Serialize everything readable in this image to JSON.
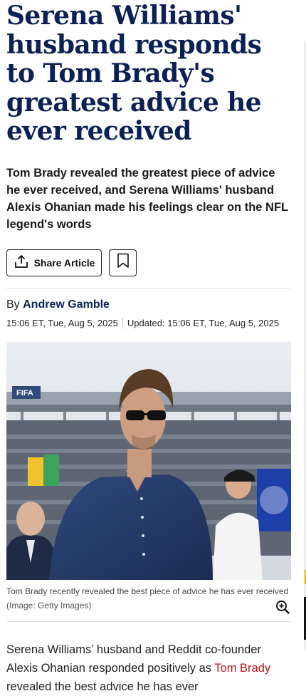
{
  "article": {
    "headline": "Serena Williams' husband responds to Tom Brady's greatest advice he ever received",
    "standfirst": "Tom Brady revealed the greatest piece of advice he ever received, and Serena Williams' husband Alexis Ohanian made his feelings clear on the NFL legend's words",
    "share_label": "Share Article",
    "byline_prefix": "By",
    "author": "Andrew Gamble",
    "published": "15:06 ET, Tue, Aug 5, 2025",
    "updated": "Updated: 15:06 ET, Tue, Aug 5, 2025",
    "image": {
      "caption": "Tom Brady recently revealed the best piece of advice he has ever received",
      "credit": "(Image: Getty Images)",
      "sign_text": "FIFA"
    },
    "body": {
      "intro": "Serena Williams’ husband and Reddit co-founder Alexis Ohanian responded positively as ",
      "link_text": "Tom Brady",
      "after_link": " revealed the best advice he has ever"
    }
  },
  "icons": {
    "share": "share-upload-icon",
    "bookmark": "bookmark-icon",
    "zoom": "zoom-in-icon"
  },
  "colors": {
    "headline": "#0b2155",
    "link": "#c4121b"
  }
}
